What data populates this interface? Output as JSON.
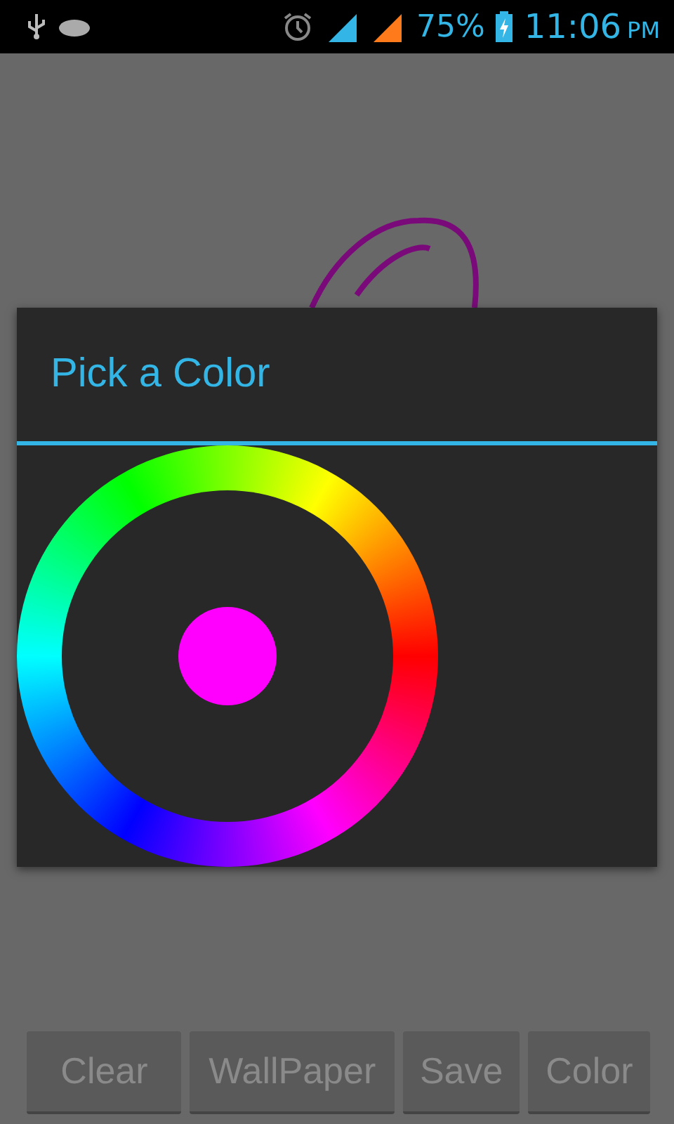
{
  "status_bar": {
    "battery_text": "75%",
    "time": "11:06",
    "meridiem": "PM"
  },
  "dialog": {
    "title": "Pick a Color"
  },
  "buttons": [
    {
      "label": "Clear"
    },
    {
      "label": "WallPaper"
    },
    {
      "label": "Save"
    },
    {
      "label": "Color"
    }
  ]
}
